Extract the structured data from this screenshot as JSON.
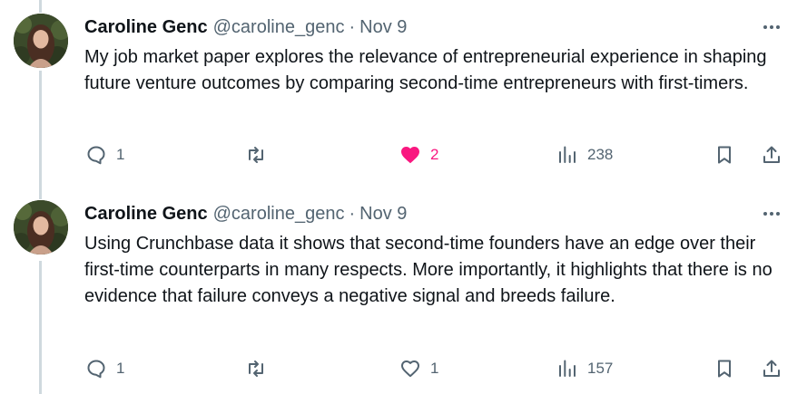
{
  "tweets": [
    {
      "author_name": "Caroline Genc",
      "handle": "@caroline_genc",
      "separator": "·",
      "date": "Nov 9",
      "text": "My job market paper explores the relevance of entrepreneurial experience in shaping future venture outcomes by comparing second-time entrepreneurs with first-timers.",
      "replies": "1",
      "retweets": "",
      "likes": "2",
      "liked": true,
      "views": "238"
    },
    {
      "author_name": "Caroline Genc",
      "handle": "@caroline_genc",
      "separator": "·",
      "date": "Nov 9",
      "text": "Using Crunchbase data it shows that second-time founders have an edge over their first-time counterparts in many respects. More importantly, it highlights that there is no evidence that failure conveys a negative signal and breeds failure.",
      "replies": "1",
      "retweets": "",
      "likes": "1",
      "liked": false,
      "views": "157"
    }
  ],
  "icons": {
    "reply": "speech-bubble-icon",
    "retweet": "retweet-arrows-icon",
    "like": "heart-icon",
    "views": "bar-chart-icon",
    "bookmark": "bookmark-icon",
    "share": "share-upload-icon",
    "more": "more-horizontal-icon"
  },
  "colors": {
    "text": "#0f1419",
    "secondary": "#536471",
    "like_active": "#f91880",
    "thread_line": "#cfd9de"
  }
}
